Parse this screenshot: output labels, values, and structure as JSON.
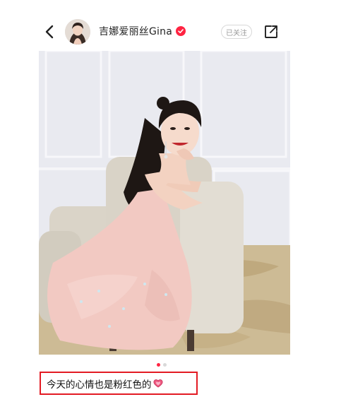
{
  "colors": {
    "brand": "#ff2442",
    "highlight_box": "#e31b23"
  },
  "header": {
    "back_icon": "chevron-left-icon",
    "author_name": "吉娜爱丽丝Gina",
    "verified_icon": "verified-badge-icon",
    "follow_label": "已关注",
    "share_icon": "share-icon"
  },
  "post": {
    "image_count": 2,
    "current_image": 1,
    "caption": "今天的心情也是粉红色的",
    "caption_emoji": "pink-heart-icon"
  }
}
